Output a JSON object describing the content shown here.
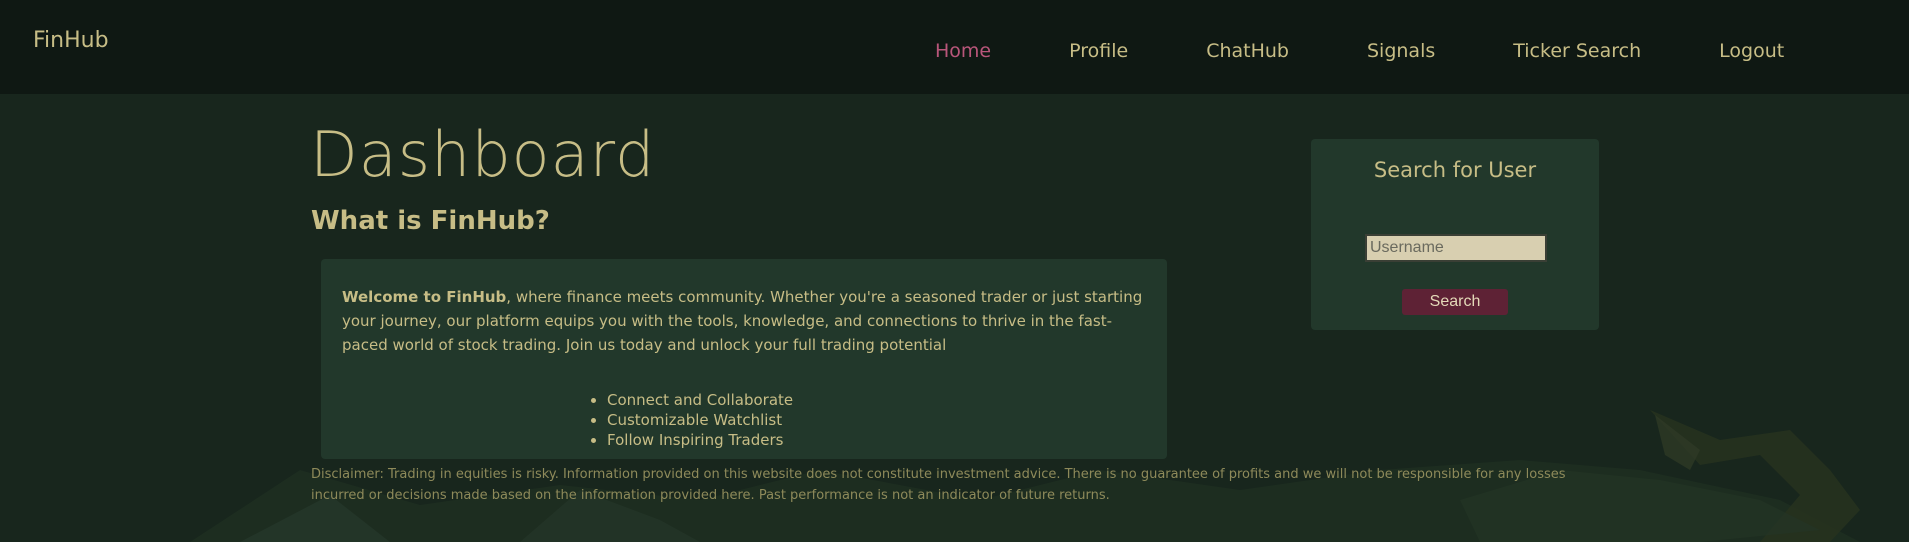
{
  "brand": "FinHub",
  "nav": {
    "items": [
      {
        "label": "Home",
        "active": true
      },
      {
        "label": "Profile"
      },
      {
        "label": "ChatHub"
      },
      {
        "label": "Signals"
      },
      {
        "label": "Ticker Search"
      },
      {
        "label": "Logout"
      }
    ]
  },
  "dashboard": {
    "title": "Dashboard",
    "subtitle": "What is FinHub?",
    "intro_bold": "Welcome to FinHub",
    "intro_text": ", where finance meets community. Whether you're a seasoned trader or just starting your journey, our platform equips you with the tools, knowledge, and connections to thrive in the fast-paced world of stock trading. Join us today and unlock your full trading potential",
    "features": [
      "Connect and Collaborate",
      "Customizable Watchlist",
      "Follow Inspiring Traders"
    ],
    "disclaimer": "Disclaimer: Trading in equities is risky. Information provided on this website does not constitute investment advice. There is no guarantee of profits and we will not be responsible for any losses incurred or decisions made based on the information provided here. Past performance is not an indicator of future returns."
  },
  "user_search": {
    "title": "Search for User",
    "placeholder": "Username",
    "value": "",
    "button_label": "Search"
  },
  "colors": {
    "background": "#18261d",
    "navbar": "#0f1813",
    "card": "#22382b",
    "text": "#c7bd86",
    "active_nav": "#b8567a",
    "button": "#5e2235"
  }
}
